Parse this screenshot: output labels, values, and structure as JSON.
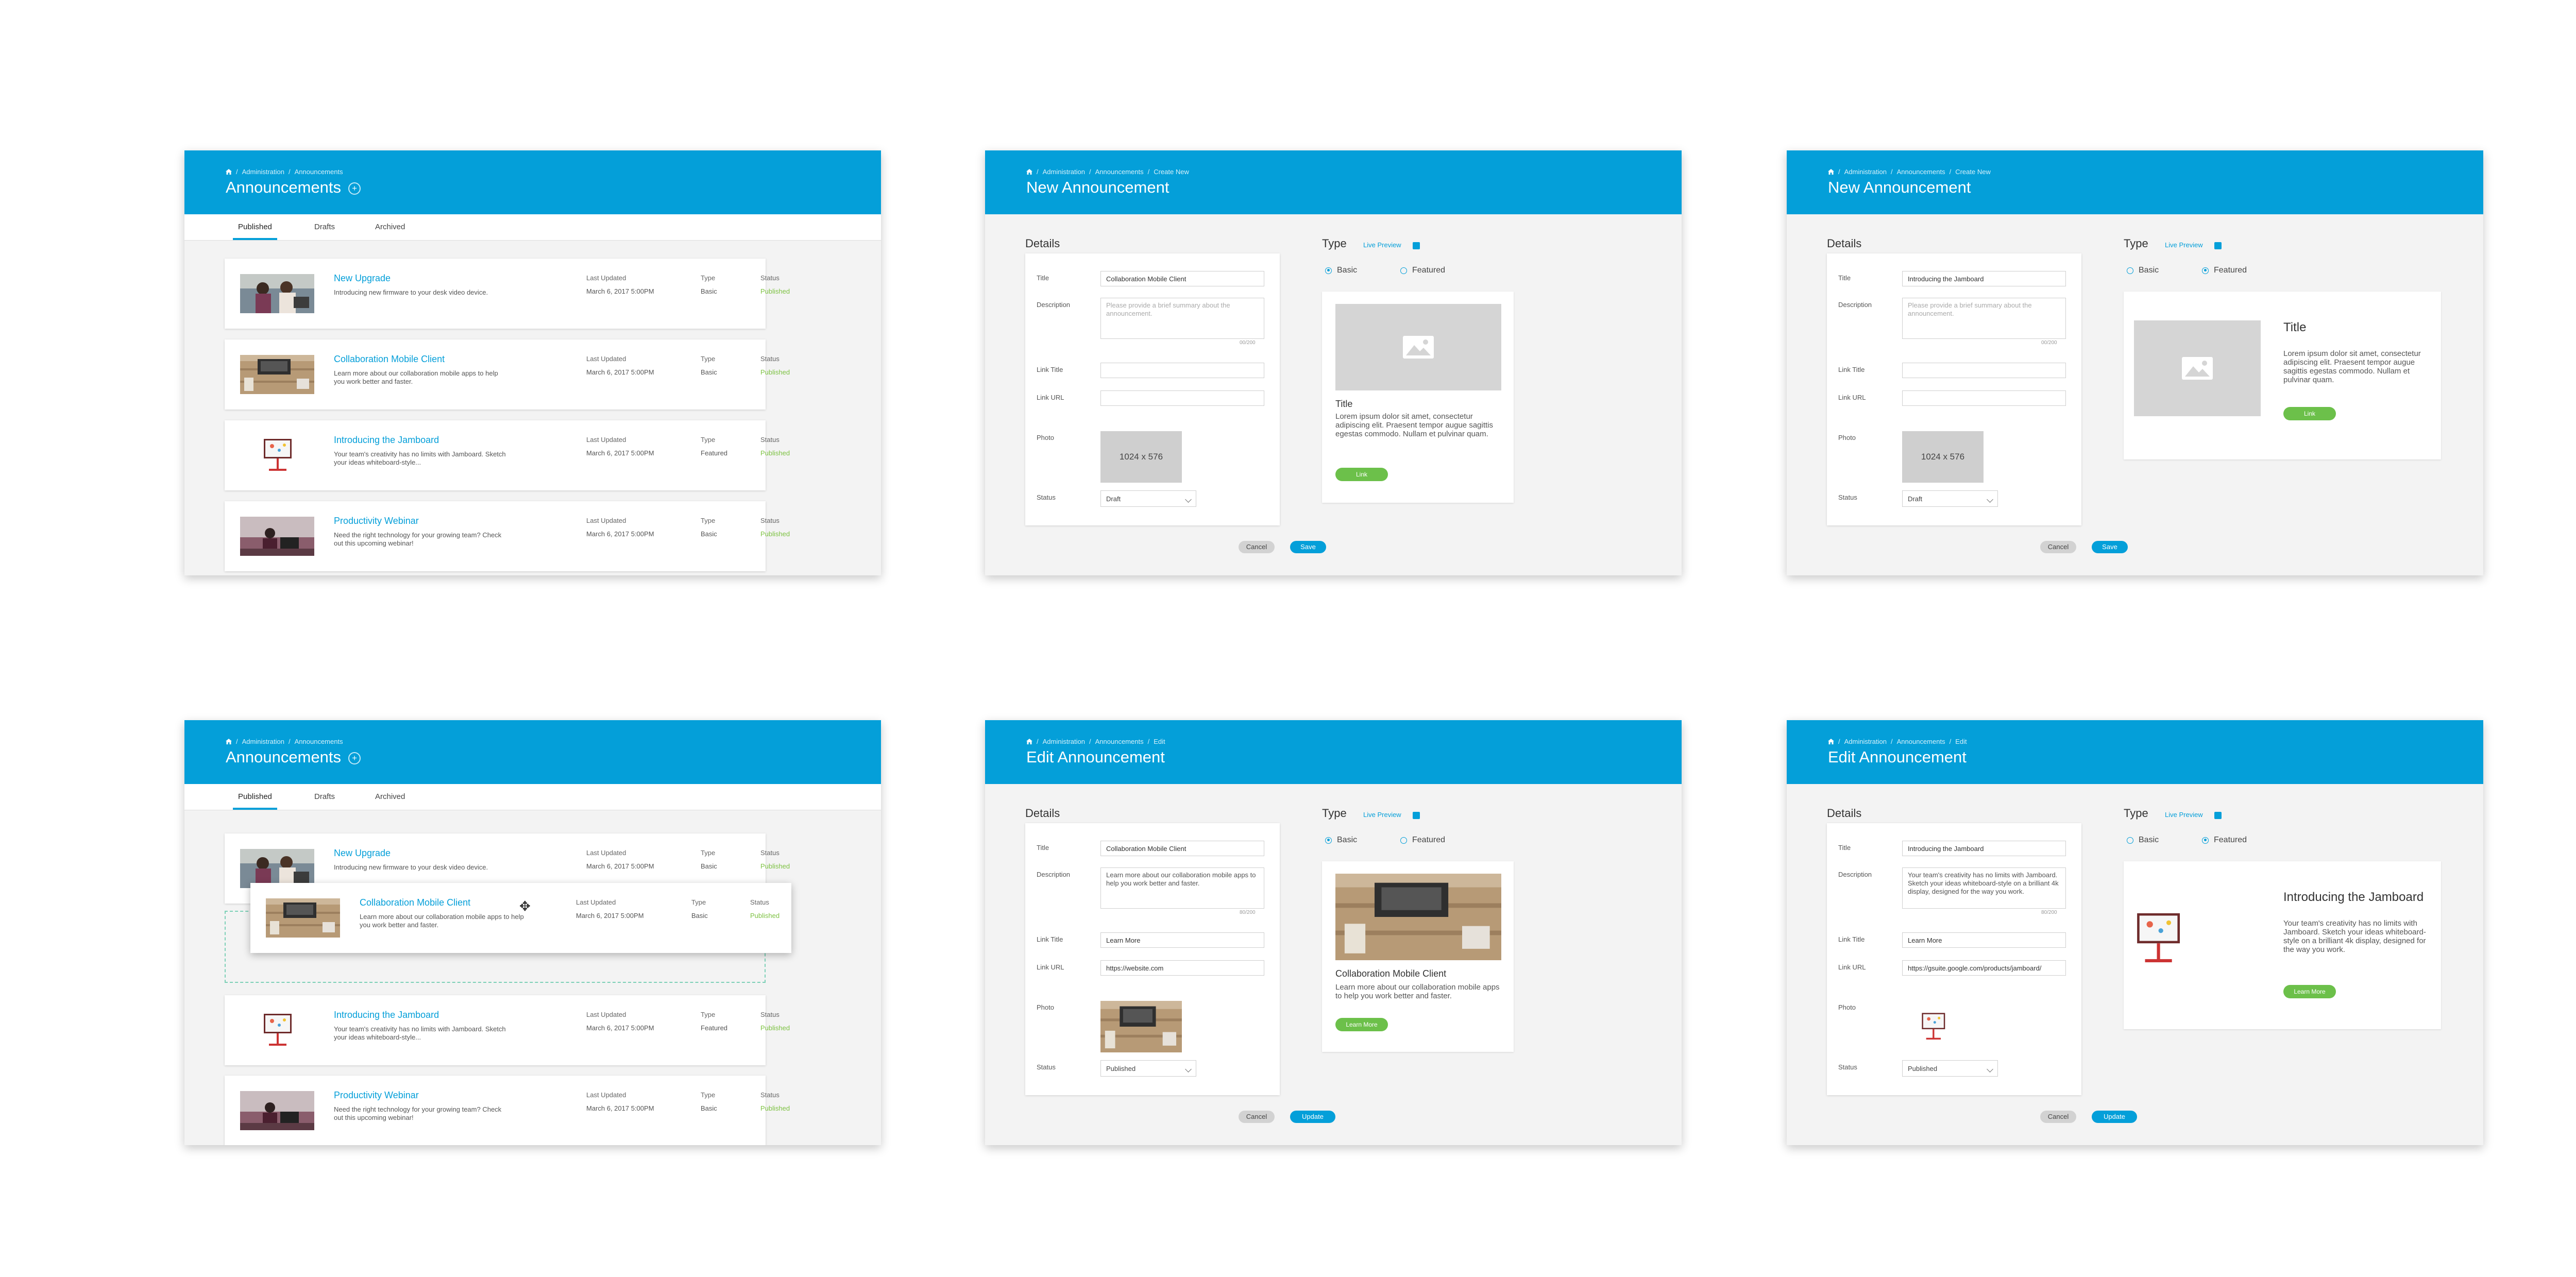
{
  "colors": {
    "header": "#049fd9",
    "accent": "#049fd9",
    "published": "#7dc242",
    "link_button": "#6cc04a",
    "background": "#f3f3f3"
  },
  "crumbs": {
    "admin": "Administration",
    "sep": "/",
    "announcements": "Announcements",
    "create": "Create New",
    "edit": "Edit"
  },
  "icons": {
    "home": "home-icon",
    "add": "plus-circle-icon",
    "toggle": "checkbox-icon",
    "move": "move-cursor-icon",
    "placeholder_image": "image-placeholder-icon",
    "select": "chevron-down-icon"
  },
  "list": {
    "title": "Announcements",
    "tabs": [
      "Published",
      "Drafts",
      "Archived"
    ],
    "col_updated": "Last Updated",
    "col_type": "Type",
    "col_status": "Status",
    "items": [
      {
        "title": "New Upgrade",
        "desc": "Introducing new firmware to your desk video device.",
        "date": "March 6, 2017  5:00PM",
        "type": "Basic",
        "status": "Published"
      },
      {
        "title": "Collaboration Mobile Client",
        "desc": "Learn more about our collaboration mobile apps to help you work better and faster.",
        "date": "March 6, 2017  5:00PM",
        "type": "Basic",
        "status": "Published"
      },
      {
        "title": "Introducing the Jamboard",
        "desc": "Your team's creativity has no limits with Jamboard. Sketch your ideas whiteboard-style...",
        "date": "March 6, 2017  5:00PM",
        "type": "Featured",
        "status": "Published"
      },
      {
        "title": "Productivity Webinar",
        "desc": "Need the right technology for your growing team? Check out this upcoming webinar!",
        "date": "March 6, 2017  5:00PM",
        "type": "Basic",
        "status": "Published"
      }
    ]
  },
  "form": {
    "new_title": "New Announcement",
    "edit_title": "Edit Announcement",
    "details": "Details",
    "title_label": "Title",
    "desc_label": "Description",
    "link_title_label": "Link Title",
    "link_url_label": "Link URL",
    "photo_label": "Photo",
    "status_label": "Status",
    "desc_placeholder": "Please provide a brief summary about the announcement.",
    "counter_empty": "00/200",
    "counter": "80/200",
    "photo_placeholder": "1024 x 576",
    "status_draft": "Draft",
    "status_published": "Published",
    "type": "Type",
    "live_preview": "Live Preview",
    "basic": "Basic",
    "featured": "Featured",
    "cancel": "Cancel",
    "save": "Save",
    "update": "Update"
  },
  "screens": {
    "new_basic": {
      "title_value": "Collaboration Mobile Client"
    },
    "new_featured": {
      "title_value": "Introducing the Jamboard"
    },
    "edit_basic": {
      "title_value": "Collaboration Mobile Client",
      "desc_value": "Learn more about our collaboration mobile apps to help you work better and faster.",
      "link_title": "Learn More",
      "link_url": "https://website.com"
    },
    "edit_featured": {
      "title_value": "Introducing the Jamboard",
      "desc_value": "Your team's creativity has no limits with Jamboard. Sketch your ideas whiteboard-style on a brilliant 4k display, designed for the way you work.",
      "link_title": "Learn More",
      "link_url": "https://gsuite.google.com/products/jamboard/"
    }
  },
  "preview": {
    "placeholder_title": "Title",
    "placeholder_desc": "Lorem ipsum dolor sit amet, consectetur adipiscing elit. Praesent tempor augue sagittis egestas commodo. Nullam et pulvinar quam.",
    "placeholder_btn": "Link",
    "basic_title": "Collaboration Mobile Client",
    "basic_desc": "Learn more about our collaboration mobile apps to help you work better and faster.",
    "featured_title": "Introducing the Jamboard",
    "featured_desc": "Your team's creativity has no limits with Jamboard. Sketch your ideas whiteboard-style on a brilliant 4k display, designed for the way you work.",
    "learn_more": "Learn More"
  }
}
